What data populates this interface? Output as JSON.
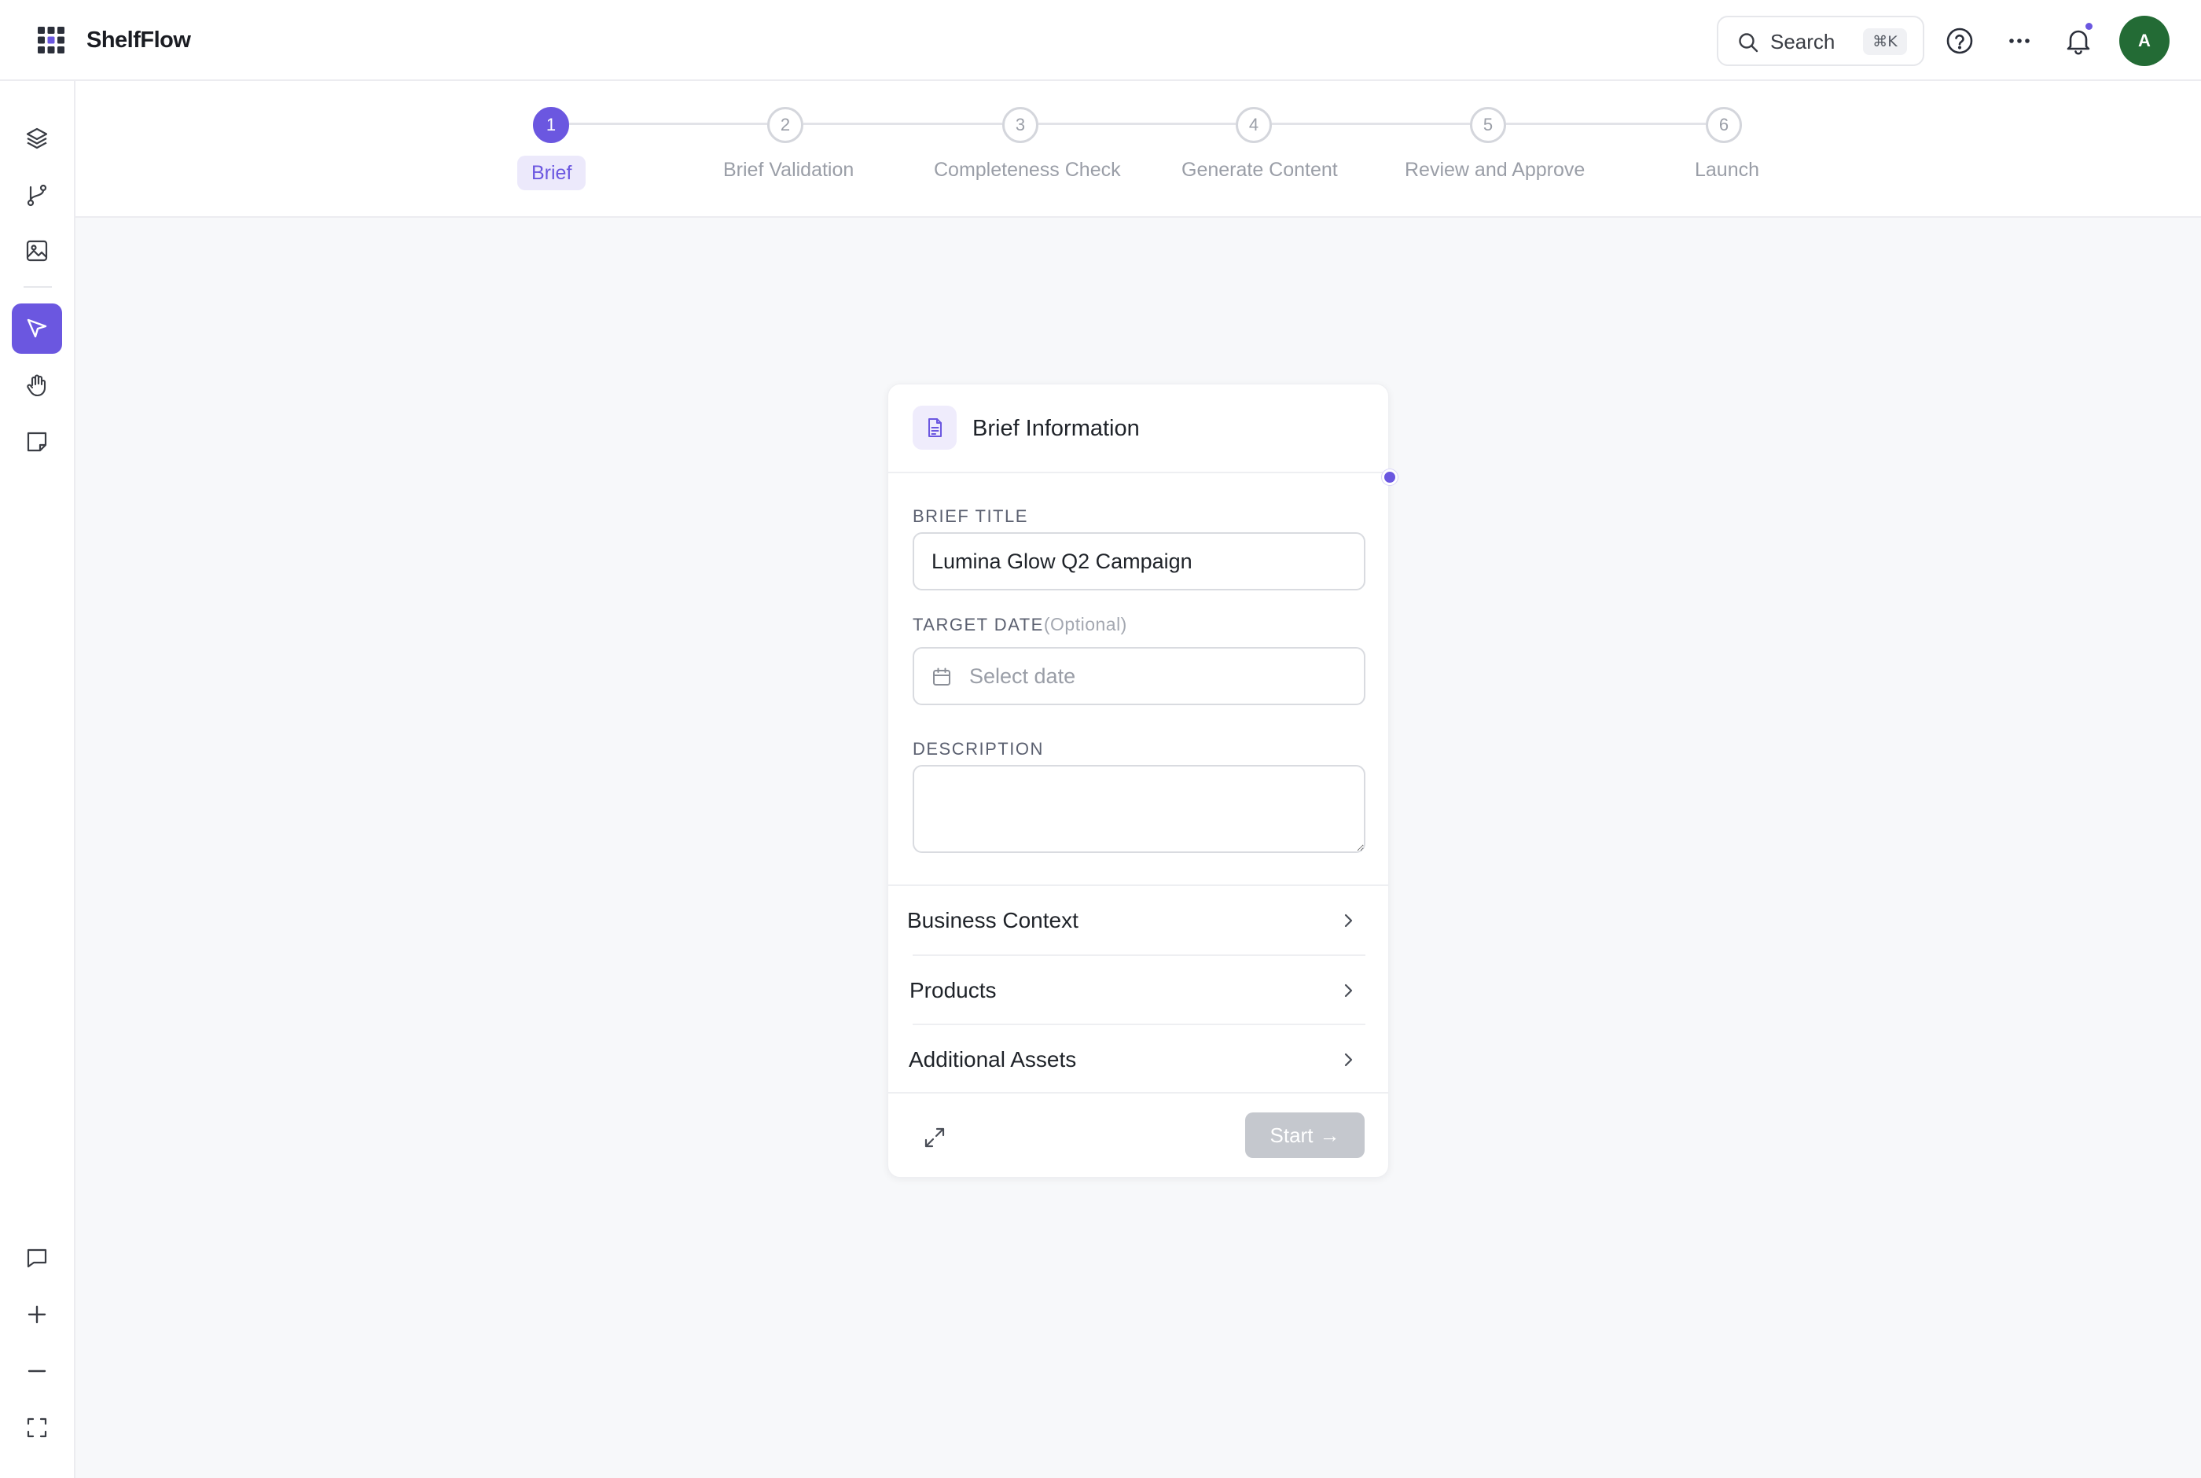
{
  "app": {
    "name": "ShelfFlow"
  },
  "header": {
    "search_label": "Search",
    "search_shortcut": "⌘K",
    "avatar_initial": "A",
    "icons": [
      "apps-grid-icon",
      "search-icon",
      "help-icon",
      "more-icon",
      "bell-icon"
    ]
  },
  "sidebar": {
    "top_tools": [
      "layers-icon",
      "flow-icon",
      "image-icon"
    ],
    "tools": [
      "pointer-icon",
      "hand-icon",
      "note-icon"
    ],
    "active_tool": "pointer-icon",
    "bottom_tools": [
      "comment-icon",
      "zoom-in-icon",
      "zoom-out-icon",
      "fit-screen-icon"
    ]
  },
  "stepper": {
    "active_step": 1,
    "steps": [
      {
        "number": "1",
        "label": "Brief"
      },
      {
        "number": "2",
        "label": "Brief Validation"
      },
      {
        "number": "3",
        "label": "Completeness Check"
      },
      {
        "number": "4",
        "label": "Generate Content"
      },
      {
        "number": "5",
        "label": "Review and Approve"
      },
      {
        "number": "6",
        "label": "Launch"
      }
    ]
  },
  "card": {
    "title": "Brief Information",
    "fields": {
      "brief_title_label": "BRIEF TITLE",
      "brief_title_value": "Lumina Glow Q2 Campaign",
      "target_date_label": "TARGET DATE",
      "target_date_optional": "(Optional)",
      "target_date_placeholder": "Select date",
      "description_label": "DESCRIPTION",
      "description_value": ""
    },
    "sections": [
      {
        "label": "Business Context"
      },
      {
        "label": "Products"
      },
      {
        "label": "Additional Assets"
      }
    ],
    "start_label": "Start",
    "start_arrow": "→",
    "start_enabled": false
  },
  "colors": {
    "accent": "#6b57e0",
    "accent_soft": "#ece9fb",
    "avatar_bg": "#236b35",
    "disabled_button": "#c5c8ce",
    "canvas_bg": "#f7f8fa"
  }
}
